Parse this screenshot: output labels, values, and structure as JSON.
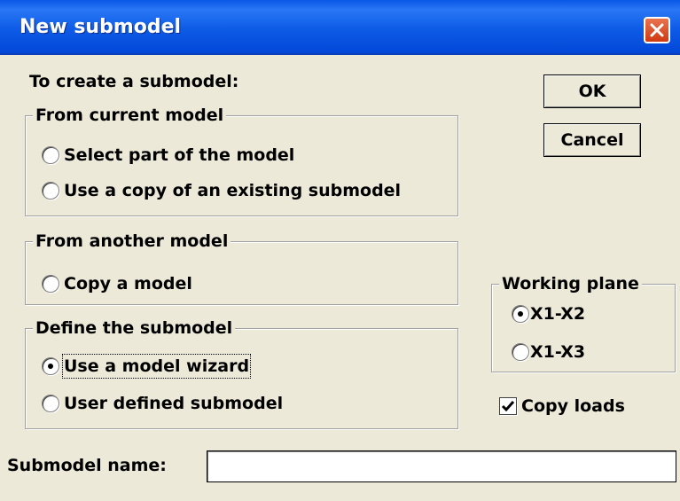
{
  "window": {
    "title": "New submodel"
  },
  "intro": "To create a submodel:",
  "group_current": {
    "legend": "From current model",
    "options": [
      "Select part of the model",
      "Use a copy of an existing submodel"
    ]
  },
  "group_another": {
    "legend": "From another model",
    "options": [
      "Copy a model"
    ]
  },
  "group_define": {
    "legend": "Define the submodel",
    "options": [
      "Use a model wizard",
      "User defined submodel"
    ],
    "selected": "Use a model wizard"
  },
  "buttons": {
    "ok": "OK",
    "cancel": "Cancel"
  },
  "working_plane": {
    "legend": "Working plane",
    "options": [
      "X1-X2",
      "X1-X3"
    ],
    "selected": "X1-X2"
  },
  "copy_loads": {
    "label": "Copy loads",
    "checked": true
  },
  "submodel_name": {
    "label": "Submodel name:",
    "value": ""
  },
  "colors": {
    "title_bar": "#0a56e8",
    "close_button": "#cf3a12",
    "dialog_bg": "#ece9d8"
  }
}
